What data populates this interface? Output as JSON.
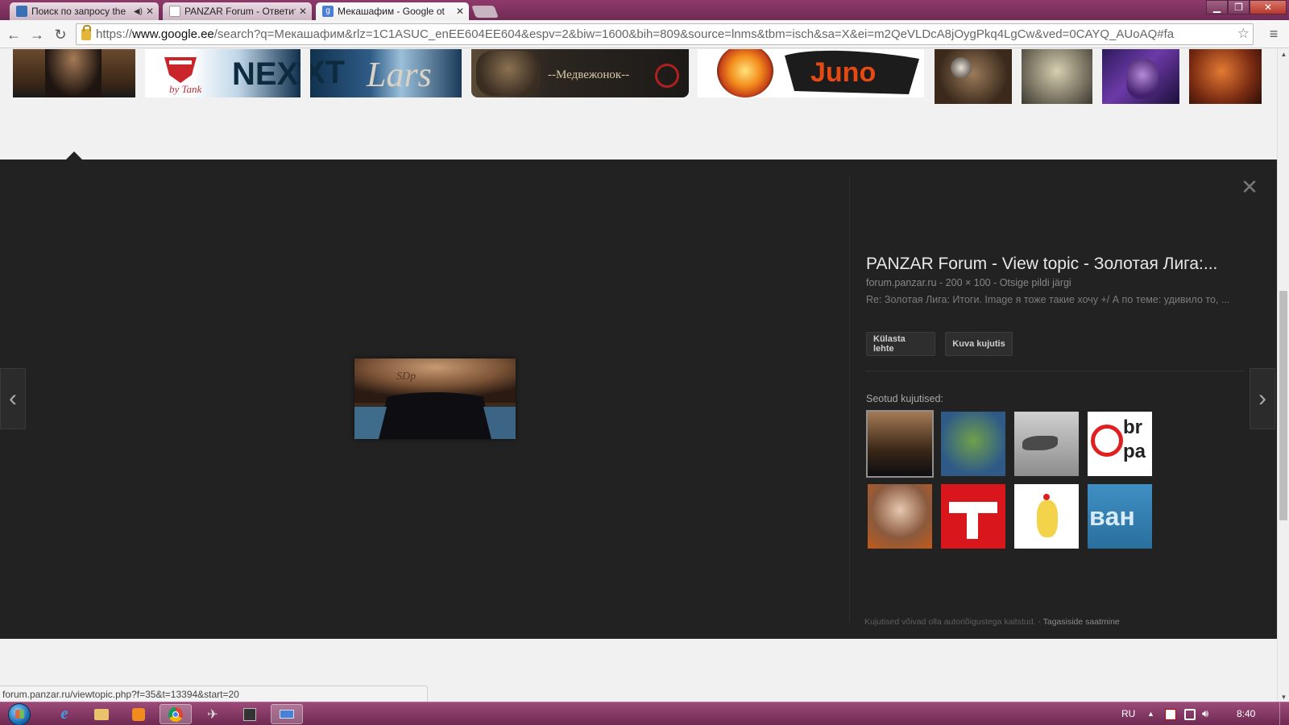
{
  "browser": {
    "tabs": [
      {
        "title": "Поиск по запросу the",
        "has_audio": true,
        "icon": "search-favicon-icon"
      },
      {
        "title": "PANZAR Forum - Ответит",
        "has_audio": false,
        "icon": "page-icon"
      },
      {
        "title": "Мекашафим - Google ot",
        "has_audio": false,
        "icon": "google-favicon-icon"
      }
    ],
    "url_scheme": "https://",
    "url_domain": "www.google.ee",
    "url_rest": "/search?q=Мекашафим&rlz=1C1ASUC_enEE604EE604&espv=2&biw=1600&bih=809&source=lnms&tbm=isch&sa=X&ei=m2QeVLDcA8jOygPkq4LgCw&ved=0CAYQ_AUoAQ#fa",
    "status_url": "forum.panzar.ru/viewtopic.php?f=35&t=13394&start=20"
  },
  "thumbnail_strip": [
    {
      "name": "thumb-photo-corset",
      "alt": ""
    },
    {
      "name": "thumb-by-tank",
      "alt": "by Tank"
    },
    {
      "name": "thumb-next",
      "alt": "NEXT"
    },
    {
      "name": "thumb-lars",
      "alt": "Lars"
    },
    {
      "name": "thumb-medvezhonok",
      "alt": "--Медвежонок--"
    },
    {
      "name": "thumb-fire-emblem",
      "alt": ""
    },
    {
      "name": "thumb-juno",
      "alt": "Juno"
    },
    {
      "name": "thumb-goblin",
      "alt": ""
    },
    {
      "name": "thumb-beast",
      "alt": ""
    },
    {
      "name": "thumb-purple-face",
      "alt": ""
    },
    {
      "name": "thumb-red-warrior",
      "alt": ""
    }
  ],
  "viewer": {
    "title": "PANZAR Forum - View topic - Золотая Лига:...",
    "source": "forum.panzar.ru",
    "dimensions": "200 × 100",
    "search_by_image": "Otsige pildi järgi",
    "description": "Re: Золотая Лига: Итоги. Image я тоже такие хочу +/ А по теме: удивило то, ...",
    "visit_page_label": "Külasta lehte",
    "view_image_label": "Kuva kujutis",
    "related_label": "Seotud kujutised:",
    "copyright_note": "Kujutised võivad olla autoriõigustega kaitstud.",
    "feedback_link": "Tagasiside saatmine",
    "main_image_text": "SDp"
  },
  "taskbar": {
    "lang": "RU",
    "time": "8:40"
  },
  "colors": {
    "window_frame": "#8e3a6a",
    "viewer_bg": "#222222",
    "page_bg": "#f1f1f1"
  }
}
